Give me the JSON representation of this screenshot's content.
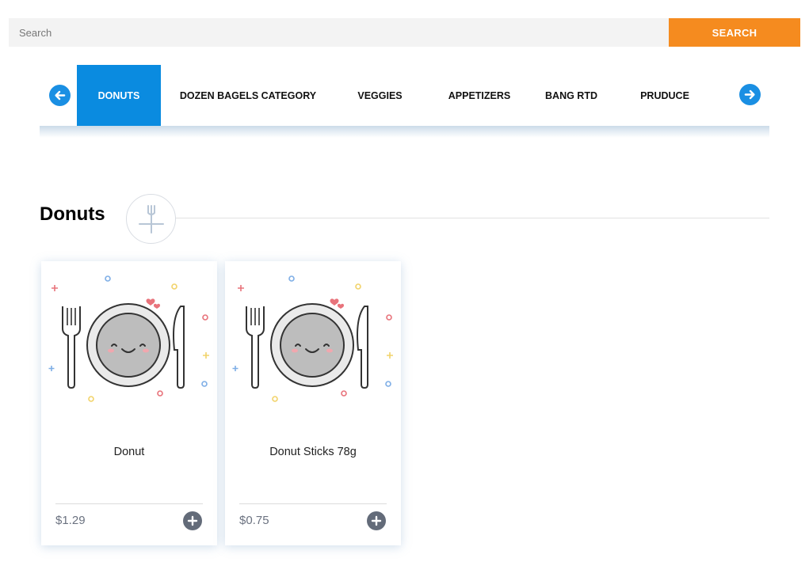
{
  "search": {
    "placeholder": "Search",
    "button_label": "SEARCH"
  },
  "colors": {
    "accent_orange": "#f58b1f",
    "active_tab_blue": "#0a8be0",
    "arrow_blue": "#1a8fe3",
    "add_button_gray": "#636b79"
  },
  "categories": {
    "prev_icon": "arrow-left-icon",
    "next_icon": "arrow-right-icon",
    "items": [
      {
        "label": "DONUTS",
        "active": true
      },
      {
        "label": "DOZEN BAGELS CATEGORY",
        "active": false
      },
      {
        "label": "VEGGIES",
        "active": false
      },
      {
        "label": "APPETIZERS",
        "active": false
      },
      {
        "label": "BANG RTD",
        "active": false
      },
      {
        "label": "PRUDUCE",
        "active": false
      }
    ]
  },
  "section": {
    "title": "Donuts",
    "icon": "fork-knife-icon"
  },
  "products": [
    {
      "name": "Donut",
      "price": "$1.29",
      "image_icon": "plate-placeholder-icon",
      "add_icon": "plus-icon"
    },
    {
      "name": "Donut Sticks 78g",
      "price": "$0.75",
      "image_icon": "plate-placeholder-icon",
      "add_icon": "plus-icon"
    }
  ]
}
